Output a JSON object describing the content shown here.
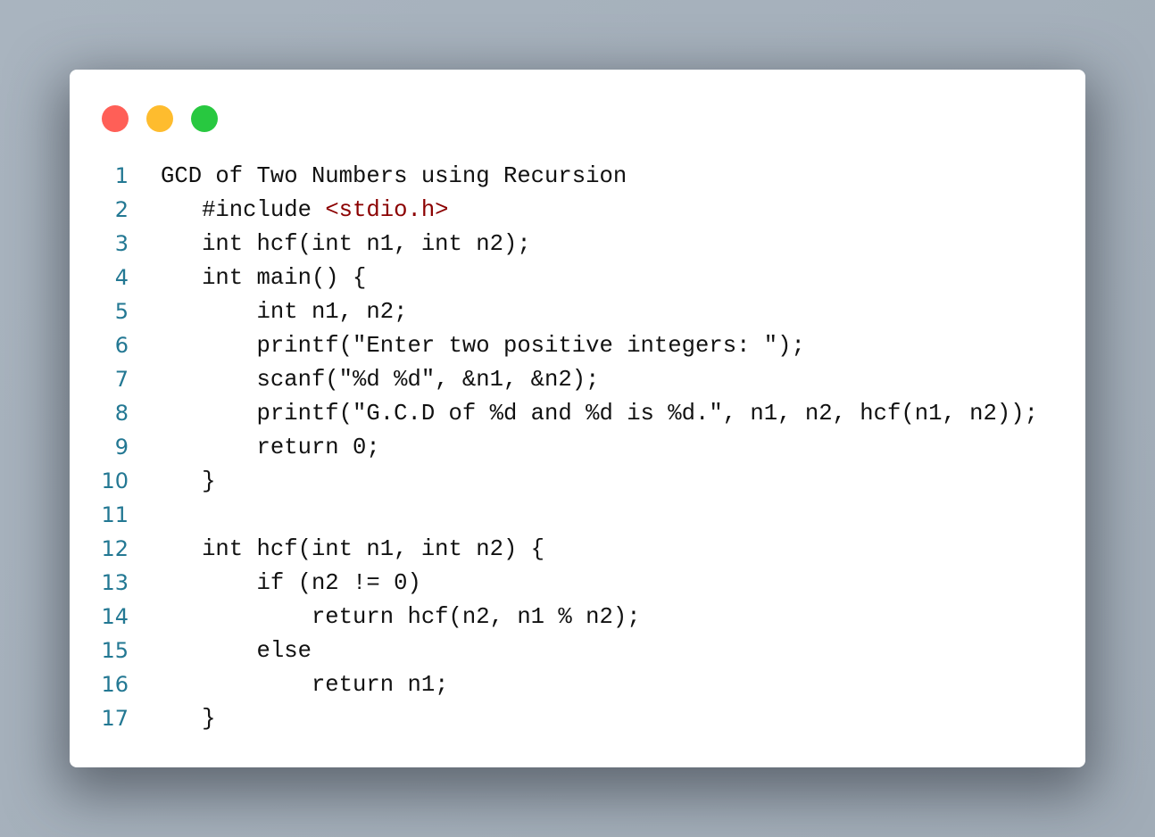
{
  "window": {
    "buttons": [
      {
        "name": "close",
        "color": "#ff5f57"
      },
      {
        "name": "minimize",
        "color": "#febc2e"
      },
      {
        "name": "maximize",
        "color": "#28c840"
      }
    ]
  },
  "colors": {
    "line_number": "#237893",
    "string": "#8b0000",
    "text": "#111111"
  },
  "code": {
    "lines": [
      {
        "n": "1",
        "parts": [
          {
            "t": "GCD of Two Numbers using Recursion"
          }
        ]
      },
      {
        "n": "2",
        "parts": [
          {
            "t": "   #include "
          },
          {
            "t": "<stdio.h>",
            "c": "str"
          }
        ]
      },
      {
        "n": "3",
        "parts": [
          {
            "t": "   int hcf(int n1, int n2);"
          }
        ]
      },
      {
        "n": "4",
        "parts": [
          {
            "t": "   int main() {"
          }
        ]
      },
      {
        "n": "5",
        "parts": [
          {
            "t": "       int n1, n2;"
          }
        ]
      },
      {
        "n": "6",
        "parts": [
          {
            "t": "       printf(\"Enter two positive integers: \");"
          }
        ]
      },
      {
        "n": "7",
        "parts": [
          {
            "t": "       scanf(\"%d %d\", &n1, &n2);"
          }
        ]
      },
      {
        "n": "8",
        "parts": [
          {
            "t": "       printf(\"G.C.D of %d and %d is %d.\", n1, n2, hcf(n1, n2));"
          }
        ]
      },
      {
        "n": "9",
        "parts": [
          {
            "t": "       return 0;"
          }
        ]
      },
      {
        "n": "10",
        "parts": [
          {
            "t": "   }"
          }
        ]
      },
      {
        "n": "11",
        "parts": [
          {
            "t": ""
          }
        ]
      },
      {
        "n": "12",
        "parts": [
          {
            "t": "   int hcf(int n1, int n2) {"
          }
        ]
      },
      {
        "n": "13",
        "parts": [
          {
            "t": "       if (n2 != 0)"
          }
        ]
      },
      {
        "n": "14",
        "parts": [
          {
            "t": "           return hcf(n2, n1 % n2);"
          }
        ]
      },
      {
        "n": "15",
        "parts": [
          {
            "t": "       else"
          }
        ]
      },
      {
        "n": "16",
        "parts": [
          {
            "t": "           return n1;"
          }
        ]
      },
      {
        "n": "17",
        "parts": [
          {
            "t": "   }"
          }
        ]
      }
    ]
  }
}
